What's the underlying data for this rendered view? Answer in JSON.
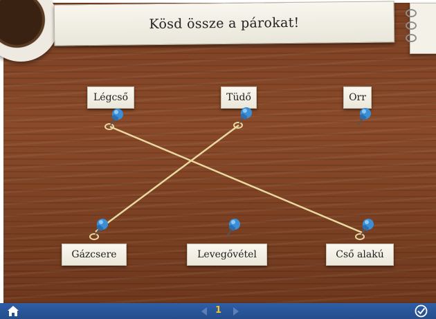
{
  "header": {
    "title": "Kösd össze a párokat!"
  },
  "top_row": [
    {
      "id": "top-1",
      "label": "Légcső"
    },
    {
      "id": "top-2",
      "label": "Tüdő"
    },
    {
      "id": "top-3",
      "label": "Orr"
    }
  ],
  "bottom_row": [
    {
      "id": "bottom-1",
      "label": "Gázcsere"
    },
    {
      "id": "bottom-2",
      "label": "Levegővétel"
    },
    {
      "id": "bottom-3",
      "label": "Cső alakú"
    }
  ],
  "connections": [
    {
      "from": "Légcső",
      "to": "Cső alakú"
    },
    {
      "from": "Tüdő",
      "to": "Gázcsere"
    }
  ],
  "footer": {
    "page_number": "1"
  },
  "colors": {
    "wood": "#7a3f22",
    "pin": "#3a8fd6",
    "string": "#e9d9a1",
    "footer": "#2f5ea6",
    "page_number": "#f2c629"
  }
}
